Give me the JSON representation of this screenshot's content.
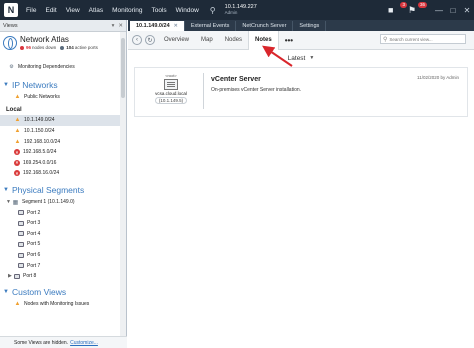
{
  "titlebar": {
    "logo_text": "N",
    "menu": [
      "File",
      "Edit",
      "View",
      "Atlas",
      "Monitoring",
      "Tools",
      "Window"
    ],
    "host_ip": "10.1.149.227",
    "host_user": "Admin",
    "alert_badge": "3",
    "notification_badge": "36"
  },
  "left": {
    "views_label": "Views",
    "atlas": {
      "title": "Network Atlas",
      "nodes_down_count": "96",
      "nodes_down_label": "nodes down",
      "active_ports_count": "104",
      "active_ports_label": "active ports"
    },
    "monitoring_dependencies": "Monitoring Dependencies",
    "ip_networks_title": "IP Networks",
    "public_networks": "Public Networks",
    "local_label": "Local",
    "local_networks": [
      {
        "label": "10.1.149.0/24",
        "status": "warn",
        "selected": true
      },
      {
        "label": "10.1.150.0/24",
        "status": "warn",
        "selected": false
      },
      {
        "label": "192.168.10.0/24",
        "status": "warn",
        "selected": false
      },
      {
        "label": "192.168.5.0/24",
        "status": "err",
        "selected": false
      },
      {
        "label": "169.254.0.0/16",
        "status": "err",
        "selected": false
      },
      {
        "label": "192.168.16.0/24",
        "status": "err",
        "selected": false
      }
    ],
    "physical_segments_title": "Physical Segments",
    "segment_label": "Segment 1 (10.1.149.0)",
    "ports": [
      "Port 2",
      "Port 3",
      "Port 4",
      "Port 5",
      "Port 6",
      "Port 7",
      "Port 8"
    ],
    "custom_views_title": "Custom Views",
    "custom_views_item": "Nodes with Monitoring Issues",
    "hidden_note": "Some Views are hidden.",
    "customize_link": "Customize..."
  },
  "tabs": [
    {
      "label": "10.1.149.0/24",
      "active": true
    },
    {
      "label": "External Events",
      "active": false
    },
    {
      "label": "NetCrunch Server",
      "active": false
    },
    {
      "label": "Settings",
      "active": false
    }
  ],
  "toolbar": {
    "view_tabs": [
      "Overview",
      "Map",
      "Nodes",
      "Notes"
    ],
    "active_view": "Notes",
    "more": "•••",
    "search_placeholder": "Search current view..."
  },
  "notes": {
    "sort_label": "Latest",
    "card": {
      "device_role": "<root>",
      "device_name": "vcsa.cloud.local",
      "device_ip": "(10.1.149.5)",
      "title": "vCenter Server",
      "body": "On-premises vCenter Server installation.",
      "date": "11/02/2020 by Admin"
    }
  },
  "colors": {
    "titlebar_bg": "#1e2a38",
    "section_blue": "#3b7bbf",
    "warn": "#f0a030",
    "error": "#d93a3a",
    "annotation_arrow": "#d9262c"
  }
}
